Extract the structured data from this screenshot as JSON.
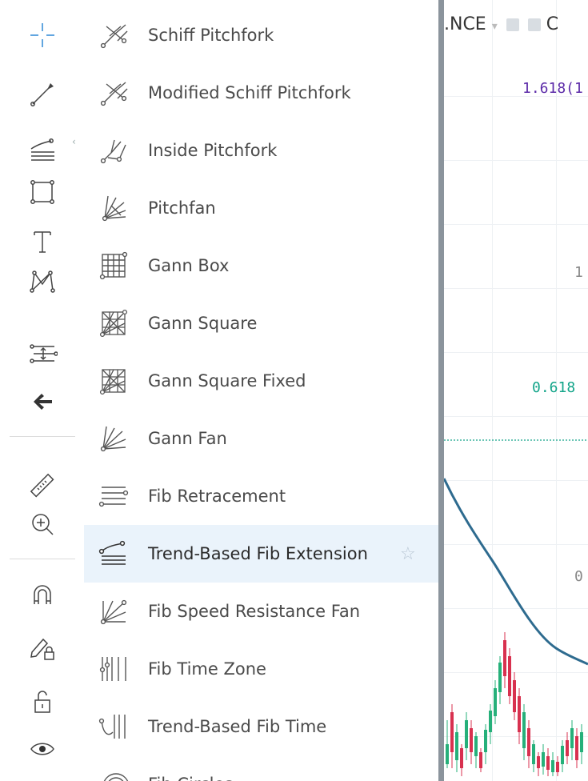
{
  "toolbar": {
    "tools": [
      {
        "name": "crosshair-icon"
      },
      {
        "name": "trend-line-icon"
      },
      {
        "name": "fib-tools-icon"
      },
      {
        "name": "rectangle-icon"
      },
      {
        "name": "text-icon"
      },
      {
        "name": "pattern-icon"
      },
      {
        "name": "prediction-icon"
      },
      {
        "name": "back-arrow-icon"
      },
      {
        "name": "ruler-icon"
      },
      {
        "name": "zoom-in-icon"
      },
      {
        "name": "magnet-icon"
      },
      {
        "name": "lock-drawing-icon"
      },
      {
        "name": "unlock-icon"
      },
      {
        "name": "eye-icon"
      }
    ],
    "expand_arrow": "‹"
  },
  "menu": {
    "items": [
      {
        "label": "Schiff Pitchfork",
        "icon": "schiff-pitchfork-icon"
      },
      {
        "label": "Modified Schiff Pitchfork",
        "icon": "modified-schiff-pitchfork-icon"
      },
      {
        "label": "Inside Pitchfork",
        "icon": "inside-pitchfork-icon"
      },
      {
        "label": "Pitchfan",
        "icon": "pitchfan-icon"
      },
      {
        "label": "Gann Box",
        "icon": "gann-box-icon"
      },
      {
        "label": "Gann Square",
        "icon": "gann-square-icon"
      },
      {
        "label": "Gann Square Fixed",
        "icon": "gann-square-fixed-icon"
      },
      {
        "label": "Gann Fan",
        "icon": "gann-fan-icon"
      },
      {
        "label": "Fib Retracement",
        "icon": "fib-retracement-icon"
      },
      {
        "label": "Trend-Based Fib Extension",
        "icon": "trend-based-fib-extension-icon",
        "selected": true
      },
      {
        "label": "Fib Speed Resistance Fan",
        "icon": "fib-speed-resistance-fan-icon"
      },
      {
        "label": "Fib Time Zone",
        "icon": "fib-time-zone-icon"
      },
      {
        "label": "Trend-Based Fib Time",
        "icon": "trend-based-fib-time-icon"
      },
      {
        "label": "Fib Circles",
        "icon": "fib-circles-icon"
      }
    ],
    "favorite_star": "☆"
  },
  "chart": {
    "title": ".NCE",
    "title_arrow": "▾",
    "title_suffix": "C",
    "fib_labels": {
      "l1618": "1.618(1",
      "l1": "1",
      "l0618": "0.618",
      "l0": "0"
    },
    "colors": {
      "fib_1618": "#5b2aa8",
      "fib_0618": "#14a58a",
      "fib_1": "#888888",
      "fib_0": "#888888",
      "line": "#2e6b8f",
      "candle_up": "#26b07a",
      "candle_down": "#d8314f"
    }
  }
}
